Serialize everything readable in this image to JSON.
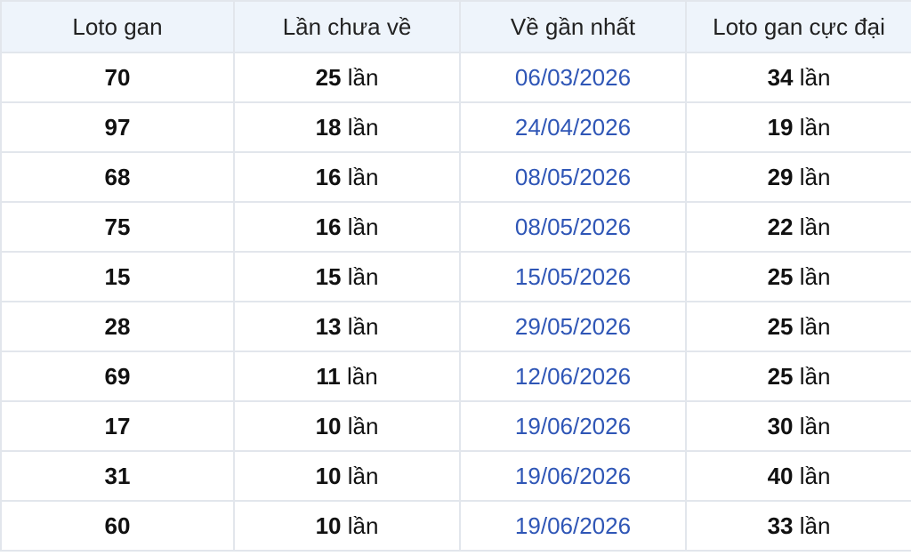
{
  "table": {
    "headers": [
      "Loto gan",
      "Lần chưa về",
      "Về gần nhất",
      "Loto gan cực đại"
    ],
    "rows": [
      {
        "loto": "70",
        "missed_count": "25",
        "last_seen": "06/03/2026",
        "max_gan": "34"
      },
      {
        "loto": "97",
        "missed_count": "18",
        "last_seen": "24/04/2026",
        "max_gan": "19"
      },
      {
        "loto": "68",
        "missed_count": "16",
        "last_seen": "08/05/2026",
        "max_gan": "29"
      },
      {
        "loto": "75",
        "missed_count": "16",
        "last_seen": "08/05/2026",
        "max_gan": "22"
      },
      {
        "loto": "15",
        "missed_count": "15",
        "last_seen": "15/05/2026",
        "max_gan": "25"
      },
      {
        "loto": "28",
        "missed_count": "13",
        "last_seen": "29/05/2026",
        "max_gan": "25"
      },
      {
        "loto": "69",
        "missed_count": "11",
        "last_seen": "12/06/2026",
        "max_gan": "25"
      },
      {
        "loto": "17",
        "missed_count": "10",
        "last_seen": "19/06/2026",
        "max_gan": "30"
      },
      {
        "loto": "31",
        "missed_count": "10",
        "last_seen": "19/06/2026",
        "max_gan": "40"
      },
      {
        "loto": "60",
        "missed_count": "10",
        "last_seen": "19/06/2026",
        "max_gan": "33"
      }
    ],
    "unit_label": "lần"
  },
  "colors": {
    "header_bg": "#eef4fb",
    "border": "#e2e6ec",
    "date_text": "#2f56b6"
  }
}
